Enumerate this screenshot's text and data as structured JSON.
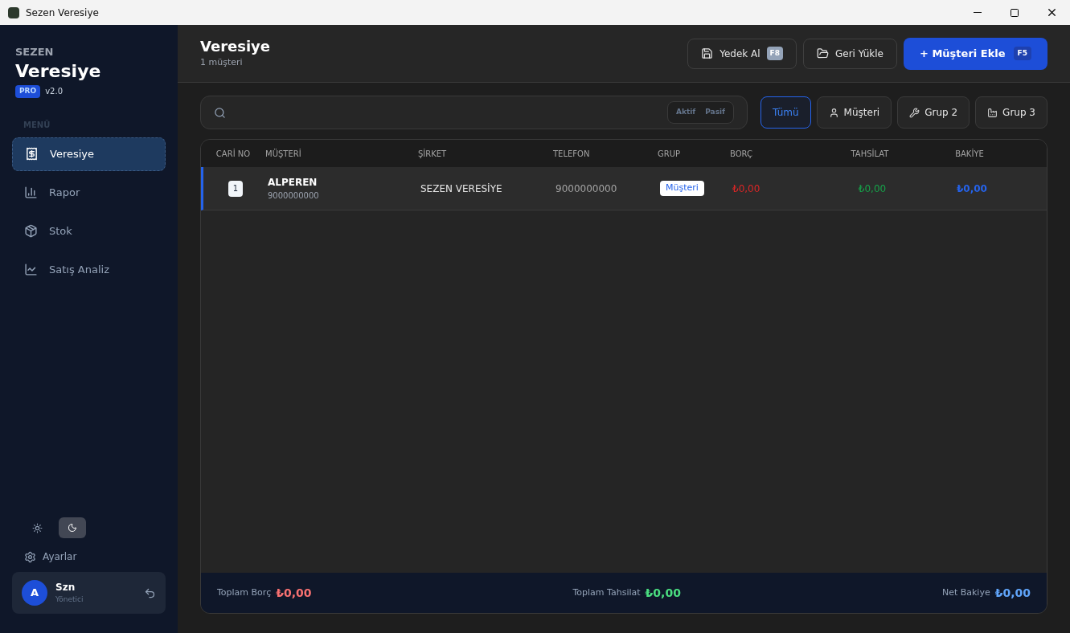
{
  "window": {
    "title": "Sezen Veresiye"
  },
  "sidebar": {
    "brand_top": "SEZEN",
    "brand": "Veresiye",
    "badge": "PRO",
    "version": "v2.0",
    "menu_label": "MENÜ",
    "items": [
      {
        "label": "Veresiye",
        "kind": "receipt",
        "selected": true
      },
      {
        "label": "Rapor",
        "kind": "bars",
        "selected": false
      },
      {
        "label": "Stok",
        "kind": "box",
        "selected": false
      },
      {
        "label": "Satış Analiz",
        "kind": "chart",
        "selected": false
      }
    ],
    "theme": [
      {
        "kind": "light",
        "selected": false
      },
      {
        "kind": "dark",
        "selected": true
      }
    ],
    "settings": "Ayarlar",
    "user": {
      "initial": "A",
      "name": "Szn",
      "role": "Yönetici"
    }
  },
  "header": {
    "title": "Veresiye",
    "subtitle": "1 müşteri",
    "buttons": [
      {
        "kind": "backup",
        "label": "Yedek Al",
        "key": "F8"
      },
      {
        "kind": "restore",
        "label": "Geri Yükle"
      },
      {
        "kind": "add",
        "label": "+ Müşteri Ekle",
        "key": "F5"
      }
    ]
  },
  "status_toggle": [
    {
      "label": "Aktif",
      "selected": false
    },
    {
      "label": "Pasif",
      "selected": false
    }
  ],
  "filters": [
    {
      "label": "Tümü",
      "kind": "all",
      "selected": true
    },
    {
      "label": "Müşteri",
      "kind": "user",
      "selected": false
    },
    {
      "label": "Grup 2",
      "kind": "wrench",
      "selected": false
    },
    {
      "label": "Grup 3",
      "kind": "factory",
      "selected": false
    }
  ],
  "table": {
    "columns": [
      "CARİ NO",
      "MÜŞTERİ",
      "ŞİRKET",
      "TELEFON",
      "GRUP",
      "BORÇ",
      "TAHSİLAT",
      "BAKİYE"
    ],
    "rows": [
      {
        "no": "1",
        "name": "ALPEREN",
        "phone_sub": "9000000000",
        "company": "SEZEN VERESİYE",
        "phone": "9000000000",
        "group": "Müşteri",
        "debt": "₺0,00",
        "collected": "₺0,00",
        "balance": "₺0,00",
        "selected": true
      }
    ]
  },
  "totals": [
    {
      "kind": "debt",
      "label": "Toplam Borç",
      "value": "₺0,00"
    },
    {
      "kind": "collected",
      "label": "Toplam Tahsilat",
      "value": "₺0,00"
    },
    {
      "kind": "balance",
      "label": "Net Bakiye",
      "value": "₺0,00"
    }
  ]
}
